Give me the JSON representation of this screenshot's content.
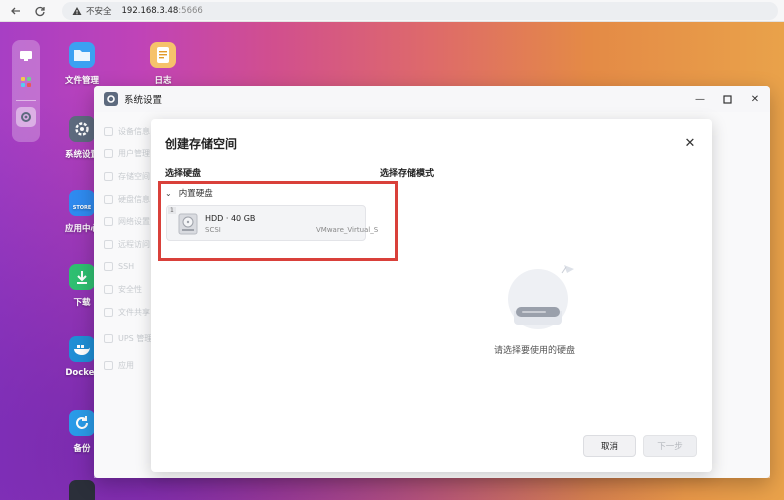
{
  "browser": {
    "security_label": "不安全",
    "url_host": "192.168.3.48",
    "url_port": ":5666"
  },
  "desktop": {
    "icons": [
      {
        "label": "文件管理",
        "icon": "folder-icon"
      },
      {
        "label": "日志",
        "icon": "log-icon"
      },
      {
        "label": "系统设置",
        "icon": "gear-icon"
      },
      {
        "label": "应用中心",
        "icon": "store-icon"
      },
      {
        "label": "下载",
        "icon": "download-icon"
      },
      {
        "label": "Docker",
        "icon": "docker-icon"
      },
      {
        "label": "备份",
        "icon": "backup-icon"
      }
    ],
    "store_badge": "STORE"
  },
  "settings_window": {
    "title": "系统设置",
    "sidebar": [
      {
        "label": "设备信息"
      },
      {
        "label": "用户管理"
      },
      {
        "label": "存储空间"
      },
      {
        "label": "硬盘信息"
      },
      {
        "label": "网络设置"
      },
      {
        "label": "远程访问"
      },
      {
        "label": "SSH"
      },
      {
        "label": "安全性"
      },
      {
        "label": "文件共享"
      },
      {
        "label": "UPS 管理"
      },
      {
        "label": "应用"
      }
    ]
  },
  "dialog": {
    "title": "创建存储空间",
    "select_disk_label": "选择硬盘",
    "select_mode_label": "选择存储模式",
    "group_label": "内置硬盘",
    "disk": {
      "index": "1",
      "name": "HDD · 40 GB",
      "interface": "SCSI",
      "model": "VMware_Virtual_S"
    },
    "empty_hint": "请选择要使用的硬盘",
    "cancel_label": "取消",
    "next_label": "下一步"
  },
  "colors": {
    "highlight_border": "#d9403a",
    "dialog_bg": "#ffffff"
  }
}
